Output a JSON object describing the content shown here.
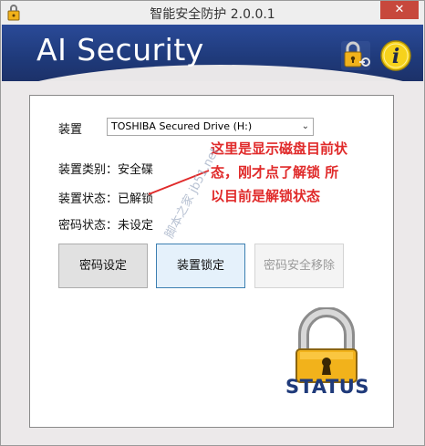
{
  "window": {
    "title": "智能安全防护 2.0.0.1",
    "close_symbol": "✕"
  },
  "banner": {
    "brand": "AI Security"
  },
  "device": {
    "label": "装置",
    "selected": "TOSHIBA Secured Drive (H:)"
  },
  "info": {
    "type_label": "装置类别：",
    "type_value": "安全碟",
    "status_label": "装置状态：",
    "status_value": "已解锁",
    "password_label": "密码状态：",
    "password_value": "未设定"
  },
  "buttons": {
    "set_password": "密码设定",
    "lock_device": "装置锁定",
    "remove_password": "密码安全移除"
  },
  "annotation": {
    "line1": "这里是显示磁盘目前状",
    "line2": "态，刚才点了解锁 所",
    "line3": "以目前是解锁状态"
  },
  "status_badge": {
    "text": "STATUS"
  },
  "watermark": {
    "text": "脚本之家 jb51.net"
  },
  "colors": {
    "banner": "#1f3a7a",
    "annotation": "#e02a2a",
    "lock_gold": "#f2b21b"
  },
  "icons": {
    "banner_lock": "lock-key-icon",
    "banner_info": "info-icon",
    "status": "padlock-icon"
  }
}
